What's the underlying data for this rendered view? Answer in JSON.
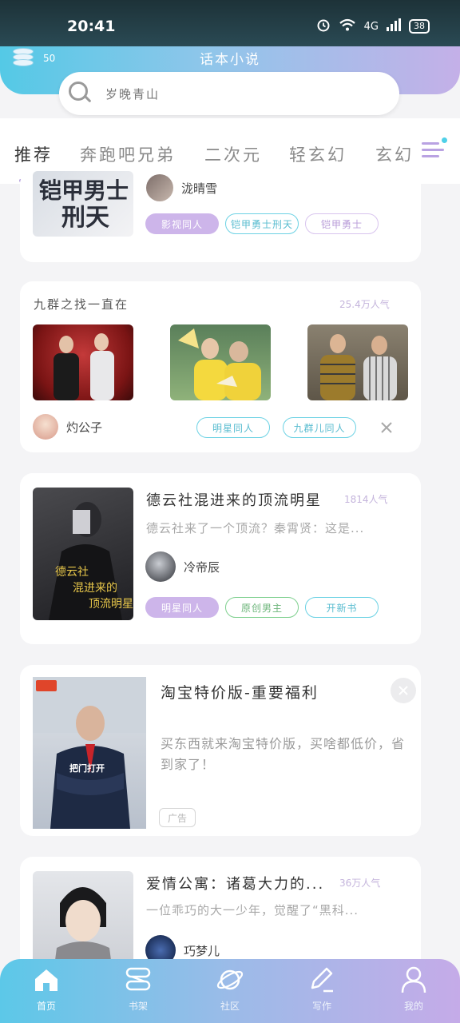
{
  "status": {
    "time": "20:41",
    "network": "4G",
    "battery": "38"
  },
  "header": {
    "title": "话本小说",
    "coins": "50"
  },
  "search": {
    "placeholder": "岁晚青山"
  },
  "tabs": [
    "推荐",
    "奔跑吧兄弟",
    "二次元",
    "轻玄幻",
    "玄幻"
  ],
  "cards": {
    "partial": {
      "author": "泷晴雪",
      "tags": [
        "影视同人",
        "铠甲勇士刑天",
        "铠甲勇士"
      ]
    },
    "group": {
      "title": "九群之找一直在",
      "heat": "25.4万人气",
      "author": "灼公子",
      "tags": [
        "明星同人",
        "九群儿同人"
      ]
    },
    "book1": {
      "title": "德云社混进来的顶流明星",
      "heat": "1814人气",
      "desc": "德云社来了一个顶流？秦霄贤：这是...",
      "author": "冷帝辰",
      "tags": [
        "明星同人",
        "原创男主",
        "开新书"
      ]
    },
    "ad": {
      "title": "淘宝特价版-重要福利",
      "desc": "买东西就来淘宝特价版，买啥都低价，省到家了！",
      "badge": "广告",
      "thumb_text": "把门打开"
    },
    "book2": {
      "title": "爱情公寓：诸葛大力的...",
      "heat": "36万人气",
      "desc": "一位乖巧的大一少年，觉醒了“黑科...",
      "author": "巧梦儿"
    }
  },
  "nav": [
    {
      "label": "首页",
      "icon": "home-icon"
    },
    {
      "label": "书架",
      "icon": "bookshelf-icon"
    },
    {
      "label": "社区",
      "icon": "planet-icon"
    },
    {
      "label": "写作",
      "icon": "pen-icon"
    },
    {
      "label": "我的",
      "icon": "user-icon"
    }
  ],
  "colors": {
    "accent_cyan": "#54c9e6",
    "accent_purple": "#c4b0e8",
    "tag_purple": "#cdb5ea"
  }
}
